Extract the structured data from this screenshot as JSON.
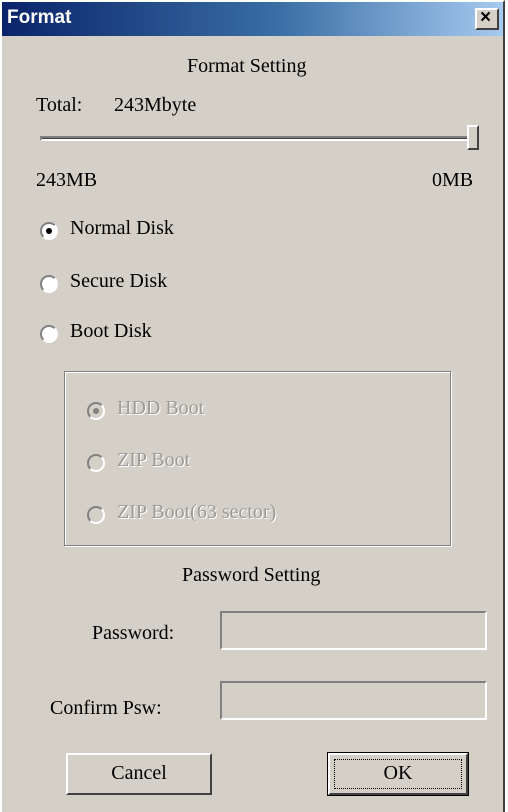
{
  "window": {
    "title": "Format",
    "close_label": "×"
  },
  "format_setting": {
    "heading": "Format Setting",
    "total_label": "Total:",
    "total_value": "243Mbyte",
    "slider": {
      "min_label": "243MB",
      "max_label": "0MB",
      "position_fraction": 1.0
    }
  },
  "disk_types": [
    {
      "label": "Normal Disk",
      "selected": true
    },
    {
      "label": "Secure Disk",
      "selected": false
    },
    {
      "label": "Boot Disk",
      "selected": false
    }
  ],
  "boot_options": [
    {
      "label": "HDD Boot",
      "selected": true,
      "enabled": false
    },
    {
      "label": "ZIP Boot",
      "selected": false,
      "enabled": false
    },
    {
      "label": "ZIP Boot(63 sector)",
      "selected": false,
      "enabled": false
    }
  ],
  "password_setting": {
    "heading": "Password Setting",
    "password_label": "Password:",
    "password_value": "",
    "confirm_label": "Confirm Psw:",
    "confirm_value": ""
  },
  "buttons": {
    "cancel": "Cancel",
    "ok": "OK"
  }
}
